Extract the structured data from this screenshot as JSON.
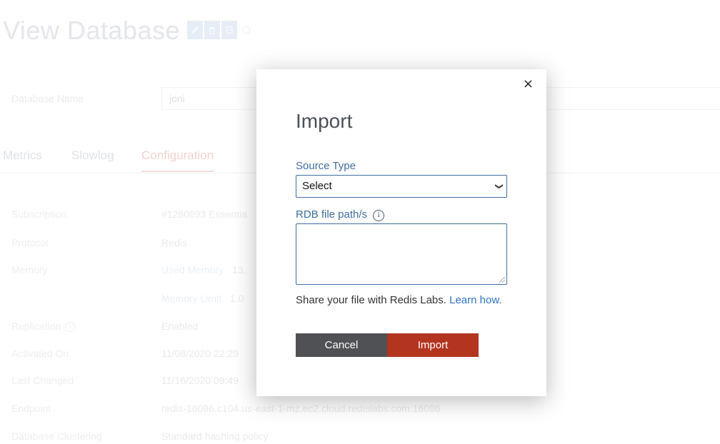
{
  "page": {
    "title": "View Database",
    "title_actions": [
      "pencil-icon",
      "trash-icon",
      "import-icon",
      "refresh-icon"
    ]
  },
  "database": {
    "name_label": "Database Name",
    "name_value": "joni"
  },
  "tabs": [
    {
      "label": "Metrics",
      "active": false
    },
    {
      "label": "Slowlog",
      "active": false
    },
    {
      "label": "Configuration",
      "active": true
    }
  ],
  "config": {
    "subscription": {
      "label": "Subscription",
      "value": "#1280893 Essentia"
    },
    "protocol": {
      "label": "Protocol",
      "value": "Redis"
    },
    "memory": {
      "label": "Memory",
      "used_label": "Used Memory",
      "used_value": "13.",
      "limit_label": "Memory Limit",
      "limit_value": "1.0"
    },
    "replication": {
      "label": "Replication",
      "value": "Enabled"
    },
    "activated_on": {
      "label": "Activated On",
      "value": "11/08/2020  22:29"
    },
    "last_changed": {
      "label": "Last Changed",
      "value": "11/16/2020  09:49"
    },
    "endpoint": {
      "label": "Endpoint",
      "value": "redis-16086.c104.us-east-1-mz.ec2.cloud.redislabs.com:16086"
    },
    "clustering": {
      "label": "Database Clustering",
      "value": "Standard hashing policy"
    }
  },
  "modal": {
    "close": "×",
    "title": "Import",
    "source_type_label": "Source Type",
    "source_type_selected": "Select",
    "rdb_label": "RDB file path/s",
    "rdb_value": "",
    "share_text": "Share your file with Redis Labs.",
    "learn_how": "Learn how.",
    "cancel_label": "Cancel",
    "import_label": "Import"
  },
  "colors": {
    "accent_blue": "#3f6fa0",
    "link_blue": "#2f73c2",
    "import_red": "#b3341f",
    "cancel_gray": "#505154"
  }
}
